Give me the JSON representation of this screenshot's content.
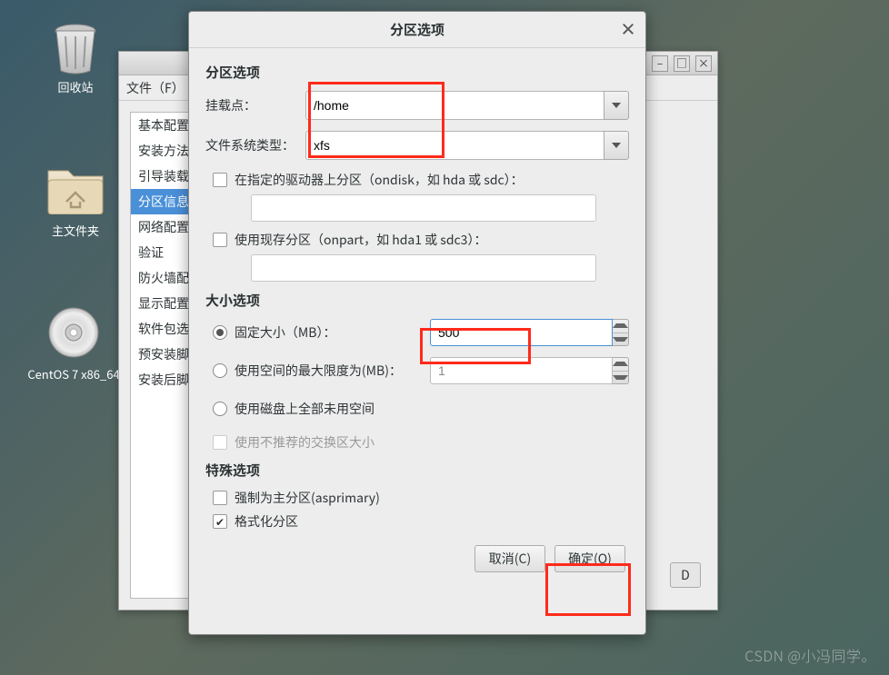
{
  "desktop": {
    "trash": "回收站",
    "home_folder": "主文件夹",
    "disc": "CentOS 7 x86_64"
  },
  "bg_window": {
    "menu_file": "文件（F）",
    "sidebar": {
      "items": [
        "基本配置",
        "安装方法",
        "引导装载",
        "分区信息",
        "网络配置",
        "验证",
        "防火墙配置",
        "显示配置",
        "软件包选择",
        "预安装脚本",
        "安装后脚本"
      ],
      "selected_index": 3
    },
    "btn_d": "D"
  },
  "dialog": {
    "title": "分区选项",
    "section_partition": "分区选项",
    "mount_label": "挂载点：",
    "mount_value": "/home",
    "fs_label": "文件系统类型：",
    "fs_value": "xfs",
    "ondisk_label": "在指定的驱动器上分区（ondisk，如 hda 或 sdc）：",
    "ondisk_value": "",
    "onpart_label": "使用现存分区（onpart，如 hda1 或 sdc3）：",
    "onpart_value": "",
    "section_size": "大小选项",
    "fixed_label": "固定大小（MB）：",
    "fixed_value": "500",
    "grow_label": "使用空间的最大限度为(MB)：",
    "grow_value": "1",
    "fill_label": "使用磁盘上全部未用空间",
    "recommended_label": "使用不推荐的交换区大小",
    "section_special": "特殊选项",
    "asprimary_label": "强制为主分区(asprimary)",
    "format_label": "格式化分区",
    "cancel": "取消(C)",
    "ok": "确定(O)"
  },
  "watermark": "CSDN @小冯同学。"
}
